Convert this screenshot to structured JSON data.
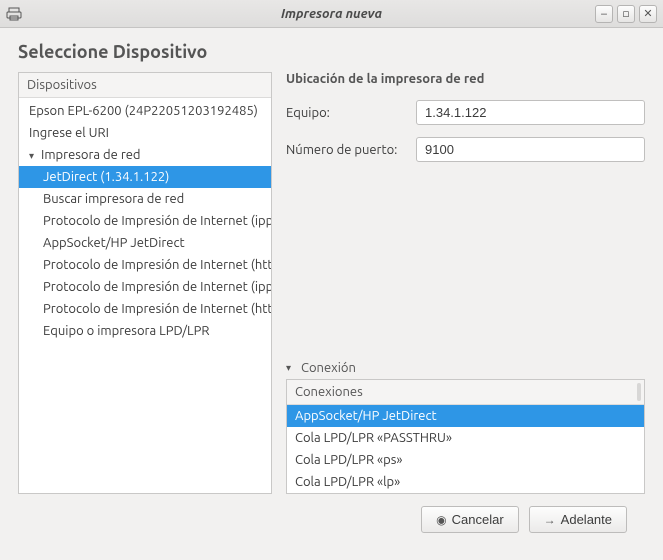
{
  "window": {
    "title": "Impresora nueva"
  },
  "page": {
    "heading": "Seleccione Dispositivo"
  },
  "devices": {
    "header": "Dispositivos",
    "items": [
      {
        "label": "Epson EPL-6200 (24P22051203192485)",
        "indent": 0,
        "expander": "",
        "selected": false
      },
      {
        "label": "Ingrese el URI",
        "indent": 0,
        "expander": "",
        "selected": false
      },
      {
        "label": "Impresora de red",
        "indent": 0,
        "expander": "▾",
        "selected": false
      },
      {
        "label": "JetDirect (1.34.1.122)",
        "indent": 1,
        "expander": "",
        "selected": true
      },
      {
        "label": "Buscar impresora de red",
        "indent": 1,
        "expander": "",
        "selected": false
      },
      {
        "label": "Protocolo de Impresión de Internet (ipp)",
        "indent": 1,
        "expander": "",
        "selected": false
      },
      {
        "label": "AppSocket/HP JetDirect",
        "indent": 1,
        "expander": "",
        "selected": false
      },
      {
        "label": "Protocolo de Impresión de Internet (https)",
        "indent": 1,
        "expander": "",
        "selected": false
      },
      {
        "label": "Protocolo de Impresión de Internet (ipps)",
        "indent": 1,
        "expander": "",
        "selected": false
      },
      {
        "label": "Protocolo de Impresión de Internet (http)",
        "indent": 1,
        "expander": "",
        "selected": false
      },
      {
        "label": "Equipo o impresora LPD/LPR",
        "indent": 1,
        "expander": "",
        "selected": false
      }
    ]
  },
  "network": {
    "title": "Ubicación de la impresora de red",
    "host_label": "Equipo:",
    "host_value": "1.34.1.122",
    "port_label": "Número de puerto:",
    "port_value": "9100"
  },
  "connection": {
    "section_label": "Conexión",
    "header": "Conexiones",
    "items": [
      {
        "label": "AppSocket/HP JetDirect",
        "selected": true
      },
      {
        "label": "Cola LPD/LPR «PASSTHRU»",
        "selected": false
      },
      {
        "label": "Cola LPD/LPR «ps»",
        "selected": false
      },
      {
        "label": "Cola LPD/LPR «lp»",
        "selected": false
      }
    ]
  },
  "footer": {
    "cancel": "Cancelar",
    "forward": "Adelante"
  }
}
